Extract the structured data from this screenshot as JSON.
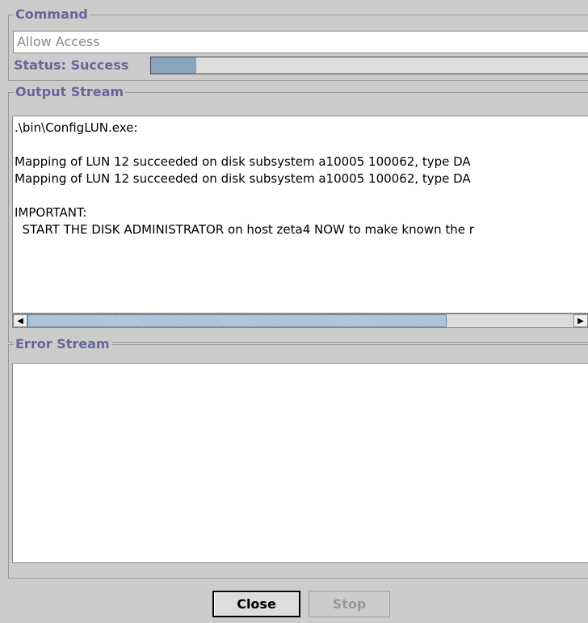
{
  "command_group": {
    "title": "Command",
    "command_value": "Allow Access",
    "status_label": "Status: Success",
    "progress": 0.1
  },
  "output_group": {
    "title": "Output Stream",
    "lines": [
      ".\\bin\\ConfigLUN.exe:",
      "",
      "Mapping of LUN 12 succeeded on disk subsystem a10005 100062, type DA",
      "Mapping of LUN 12 succeeded on disk subsystem a10005 100062, type DA",
      "",
      "IMPORTANT:",
      "  START THE DISK ADMINISTRATOR on host zeta4 NOW to make known the r"
    ]
  },
  "error_group": {
    "title": "Error Stream",
    "lines": []
  },
  "buttons": {
    "close_label": "Close",
    "stop_label": "Stop"
  },
  "icons": {
    "scroll_left": "arrow-left-icon",
    "scroll_right": "arrow-right-icon"
  }
}
